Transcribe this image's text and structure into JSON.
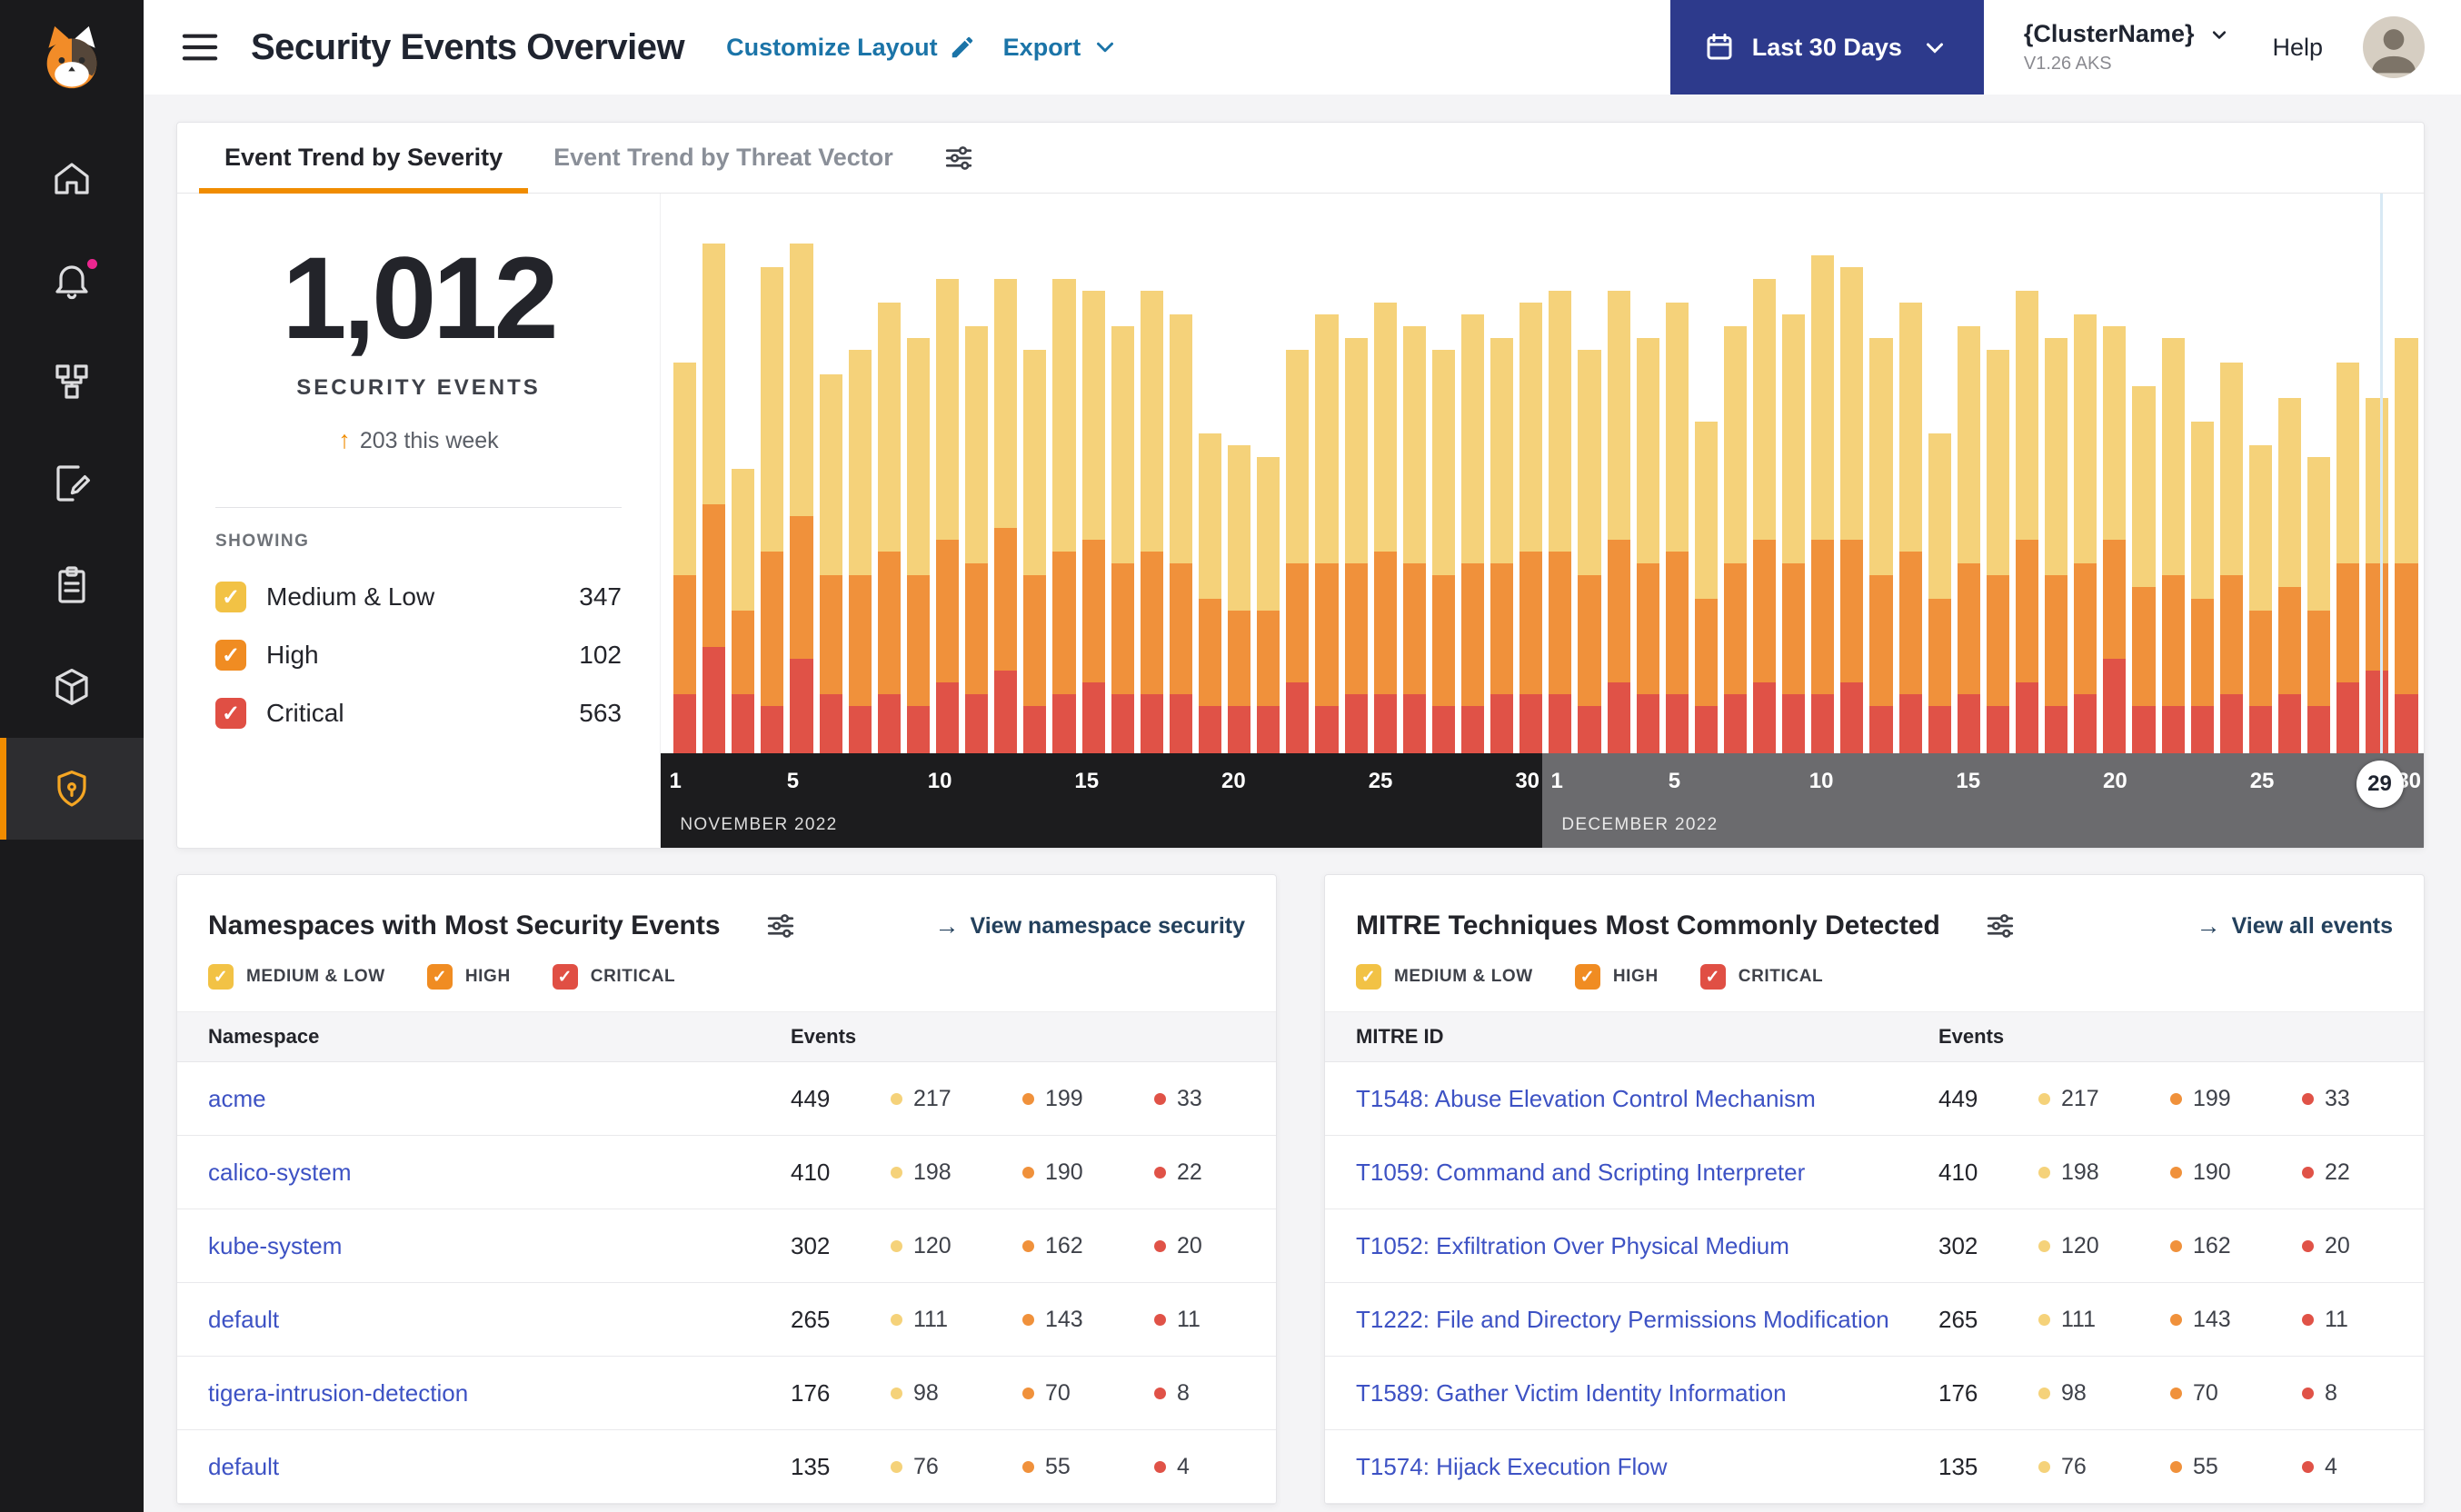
{
  "colors": {
    "accent_orange": "#F08C00",
    "link_blue": "#3D52C4",
    "header_link": "#1B74A8",
    "navy_button": "#2D3A8C",
    "notification_pink": "#EC268F"
  },
  "severity_colors": {
    "medium_low": "#F5D27A",
    "high": "#F0913B",
    "critical": "#E05247"
  },
  "sidebar": {
    "logo": "calico-cat-logo",
    "items": [
      {
        "icon": "home-icon",
        "active": false
      },
      {
        "icon": "bell-icon",
        "active": false,
        "notification_badge": true
      },
      {
        "icon": "service-graph-icon",
        "active": false
      },
      {
        "icon": "policies-icon",
        "active": false
      },
      {
        "icon": "compliance-clipboard-icon",
        "active": false
      },
      {
        "icon": "images-package-icon",
        "active": false
      },
      {
        "icon": "threat-shield-icon",
        "active": true
      }
    ]
  },
  "header": {
    "title": "Security Events Overview",
    "customize_label": "Customize Layout",
    "export_label": "Export",
    "date_range_label": "Last 30 Days",
    "cluster_name": "{ClusterName}",
    "cluster_version": "V1.26 AKS",
    "help_label": "Help"
  },
  "trend_card": {
    "tabs": [
      {
        "label": "Event Trend by Severity",
        "active": true
      },
      {
        "label": "Event Trend by Threat Vector",
        "active": false
      }
    ],
    "total": "1,012",
    "total_label": "SECURITY EVENTS",
    "delta": "203 this week",
    "showing_label": "SHOWING",
    "filters": [
      {
        "label": "Medium & Low",
        "count": "347",
        "color": "#F2C245",
        "checked": true
      },
      {
        "label": "High",
        "count": "102",
        "color": "#F08C22",
        "checked": true
      },
      {
        "label": "Critical",
        "count": "563",
        "color": "#E04F44",
        "checked": true
      }
    ]
  },
  "chart_data": {
    "type": "bar",
    "stacked": true,
    "title": "",
    "xlabel": "",
    "ylabel": "",
    "legend_position": "left-panel-checkboxes",
    "grid": false,
    "months": [
      {
        "label": "NOVEMBER 2022",
        "days": 30,
        "band_color": "#1C1C1E"
      },
      {
        "label": "DECEMBER 2022",
        "days": 30,
        "band_color": "#6B6B6E"
      }
    ],
    "ticks": [
      1,
      5,
      10,
      15,
      20,
      25,
      30
    ],
    "selected": {
      "month_index": 1,
      "day": 29
    },
    "series": [
      {
        "name": "Medium & Low",
        "color": "#F5D27A",
        "values": [
          18,
          22,
          12,
          24,
          23,
          17,
          19,
          21,
          20,
          22,
          20,
          21,
          19,
          23,
          21,
          20,
          22,
          21,
          14,
          14,
          13,
          18,
          21,
          19,
          21,
          20,
          19,
          21,
          19,
          21,
          22,
          19,
          21,
          19,
          21,
          15,
          20,
          22,
          21,
          24,
          23,
          20,
          21,
          14,
          20,
          19,
          21,
          20,
          21,
          18,
          17,
          20,
          15,
          18,
          14,
          16,
          13,
          17,
          14,
          19
        ]
      },
      {
        "name": "High",
        "color": "#F0913B",
        "values": [
          10,
          12,
          7,
          13,
          12,
          10,
          11,
          12,
          11,
          12,
          11,
          12,
          11,
          12,
          12,
          11,
          12,
          11,
          9,
          8,
          8,
          10,
          12,
          11,
          12,
          11,
          11,
          12,
          11,
          12,
          12,
          11,
          12,
          11,
          12,
          9,
          11,
          12,
          11,
          13,
          12,
          11,
          12,
          9,
          11,
          11,
          12,
          11,
          11,
          10,
          10,
          11,
          9,
          10,
          8,
          9,
          8,
          10,
          9,
          11
        ]
      },
      {
        "name": "Critical",
        "color": "#E05247",
        "values": [
          5,
          9,
          5,
          4,
          8,
          5,
          4,
          5,
          4,
          6,
          5,
          7,
          4,
          5,
          6,
          5,
          5,
          5,
          4,
          4,
          4,
          6,
          4,
          5,
          5,
          5,
          4,
          4,
          5,
          5,
          5,
          4,
          6,
          5,
          5,
          4,
          5,
          6,
          5,
          5,
          6,
          4,
          5,
          4,
          5,
          4,
          6,
          4,
          5,
          8,
          4,
          4,
          4,
          5,
          4,
          5,
          4,
          6,
          7,
          5
        ]
      }
    ]
  },
  "namespaces_card": {
    "title": "Namespaces with Most Security Events",
    "link": "View namespace security",
    "filters": [
      {
        "label": "MEDIUM & LOW",
        "color": "#F2C245",
        "checked": true
      },
      {
        "label": "HIGH",
        "color": "#F08C22",
        "checked": true
      },
      {
        "label": "CRITICAL",
        "color": "#E04F44",
        "checked": true
      }
    ],
    "columns": [
      "Namespace",
      "Events"
    ],
    "rows": [
      {
        "name": "acme",
        "events": "449",
        "medium": "217",
        "high": "199",
        "critical": "33"
      },
      {
        "name": "calico-system",
        "events": "410",
        "medium": "198",
        "high": "190",
        "critical": "22"
      },
      {
        "name": "kube-system",
        "events": "302",
        "medium": "120",
        "high": "162",
        "critical": "20"
      },
      {
        "name": "default",
        "events": "265",
        "medium": "111",
        "high": "143",
        "critical": "11"
      },
      {
        "name": "tigera-intrusion-detection",
        "events": "176",
        "medium": "98",
        "high": "70",
        "critical": "8"
      },
      {
        "name": "default",
        "events": "135",
        "medium": "76",
        "high": "55",
        "critical": "4"
      }
    ]
  },
  "mitre_card": {
    "title": "MITRE Techniques Most Commonly Detected",
    "link": "View all events",
    "filters": [
      {
        "label": "MEDIUM & LOW",
        "color": "#F2C245",
        "checked": true
      },
      {
        "label": "HIGH",
        "color": "#F08C22",
        "checked": true
      },
      {
        "label": "CRITICAL",
        "color": "#E04F44",
        "checked": true
      }
    ],
    "columns": [
      "MITRE ID",
      "Events"
    ],
    "rows": [
      {
        "name": "T1548: Abuse Elevation Control Mechanism",
        "events": "449",
        "medium": "217",
        "high": "199",
        "critical": "33"
      },
      {
        "name": "T1059: Command and Scripting Interpreter",
        "events": "410",
        "medium": "198",
        "high": "190",
        "critical": "22"
      },
      {
        "name": "T1052: Exfiltration Over Physical Medium",
        "events": "302",
        "medium": "120",
        "high": "162",
        "critical": "20"
      },
      {
        "name": "T1222: File and Directory Permissions Modification",
        "events": "265",
        "medium": "111",
        "high": "143",
        "critical": "11"
      },
      {
        "name": "T1589: Gather Victim Identity Information",
        "events": "176",
        "medium": "98",
        "high": "70",
        "critical": "8"
      },
      {
        "name": "T1574: Hijack Execution Flow",
        "events": "135",
        "medium": "76",
        "high": "55",
        "critical": "4"
      }
    ]
  }
}
